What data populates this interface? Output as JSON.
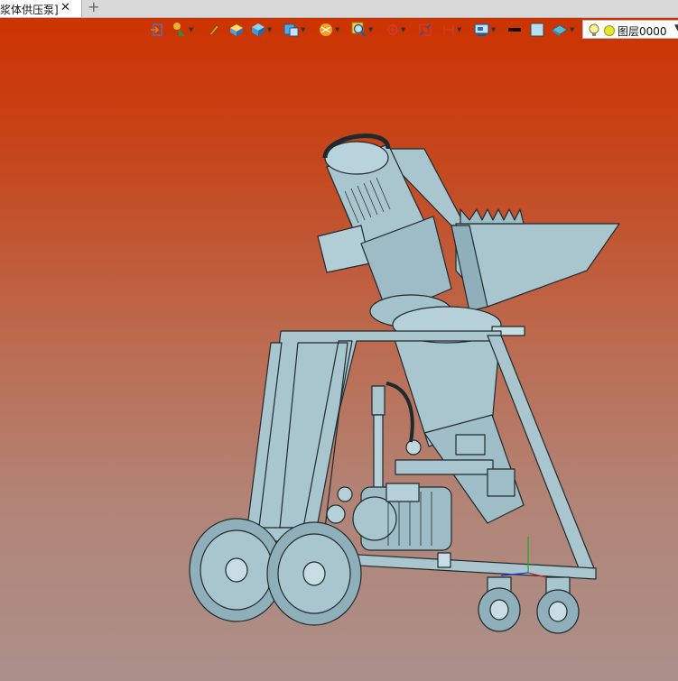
{
  "document_tab": {
    "title": "浆体供压泵]",
    "close_glyph": "✕",
    "new_tab_glyph": "+"
  },
  "toolbar": {
    "tools": [
      {
        "icon": "view-entry-icon",
        "dropdown": false
      },
      {
        "icon": "select-filter-icon",
        "dropdown": true
      },
      {
        "icon": "pen-icon",
        "dropdown": false
      },
      {
        "icon": "solid-box-icon",
        "dropdown": false
      },
      {
        "icon": "cube-icon",
        "dropdown": true
      },
      {
        "icon": "view-cube-icon",
        "dropdown": true
      },
      {
        "icon": "render-style-icon",
        "dropdown": true
      },
      {
        "icon": "zoom-icon",
        "dropdown": true
      },
      {
        "icon": "orbit-icon",
        "dropdown": true
      },
      {
        "icon": "section-icon",
        "dropdown": false
      },
      {
        "icon": "dimension-icon",
        "dropdown": true
      },
      {
        "icon": "display-icon",
        "dropdown": true
      },
      {
        "icon": "line-color-icon",
        "dropdown": false
      },
      {
        "icon": "fill-color-icon",
        "dropdown": false
      },
      {
        "icon": "material-icon",
        "dropdown": true
      }
    ],
    "layer_selector": {
      "label": "图层0000",
      "bulb_icon": "lightbulb-icon",
      "color_swatch": "#e6e62e"
    }
  },
  "viewport": {
    "background_top": "#cc3300",
    "background_bottom": "#ab908a",
    "model_color": "#a9c6cf",
    "model_dark": "#6f8f98"
  }
}
